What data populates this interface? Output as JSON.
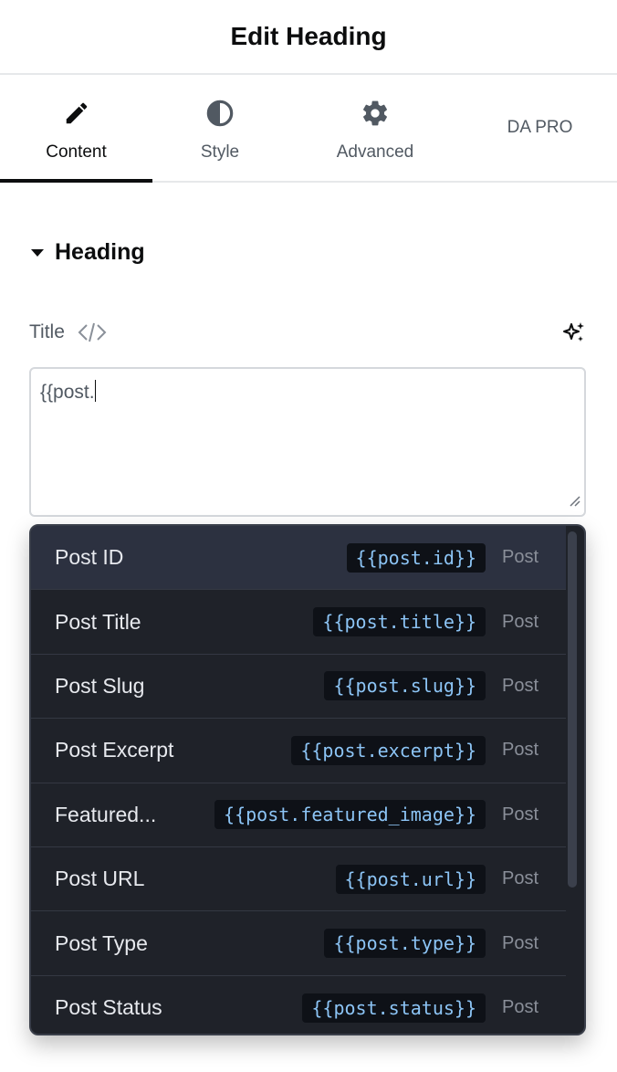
{
  "header": {
    "title": "Edit Heading"
  },
  "tabs": [
    {
      "label": "Content",
      "icon": "pencil-icon",
      "active": true
    },
    {
      "label": "Style",
      "icon": "contrast-icon",
      "active": false
    },
    {
      "label": "Advanced",
      "icon": "gear-icon",
      "active": false
    },
    {
      "label": "DA PRO",
      "icon": "",
      "active": false
    }
  ],
  "section": {
    "title": "Heading",
    "icon": "caret-down-icon"
  },
  "field": {
    "label": "Title",
    "label_icon": "dynamic-tags-icon",
    "action_icon": "ai-sparkle-icon",
    "value": "{{post."
  },
  "dropdown": {
    "items": [
      {
        "name": "Post ID",
        "token": "{{post.id}}",
        "group": "Post"
      },
      {
        "name": "Post Title",
        "token": "{{post.title}}",
        "group": "Post"
      },
      {
        "name": "Post Slug",
        "token": "{{post.slug}}",
        "group": "Post"
      },
      {
        "name": "Post Excerpt",
        "token": "{{post.excerpt}}",
        "group": "Post"
      },
      {
        "name": "Featured...",
        "token": "{{post.featured_image}}",
        "group": "Post"
      },
      {
        "name": "Post URL",
        "token": "{{post.url}}",
        "group": "Post"
      },
      {
        "name": "Post Type",
        "token": "{{post.type}}",
        "group": "Post"
      },
      {
        "name": "Post Status",
        "token": "{{post.status}}",
        "group": "Post"
      }
    ]
  },
  "colors": {
    "text": "#0c0d0e",
    "muted": "#515962",
    "dropdown_bg": "#1f2229",
    "dropdown_highlight": "#2c3140",
    "token_text": "#8cc4f5"
  }
}
